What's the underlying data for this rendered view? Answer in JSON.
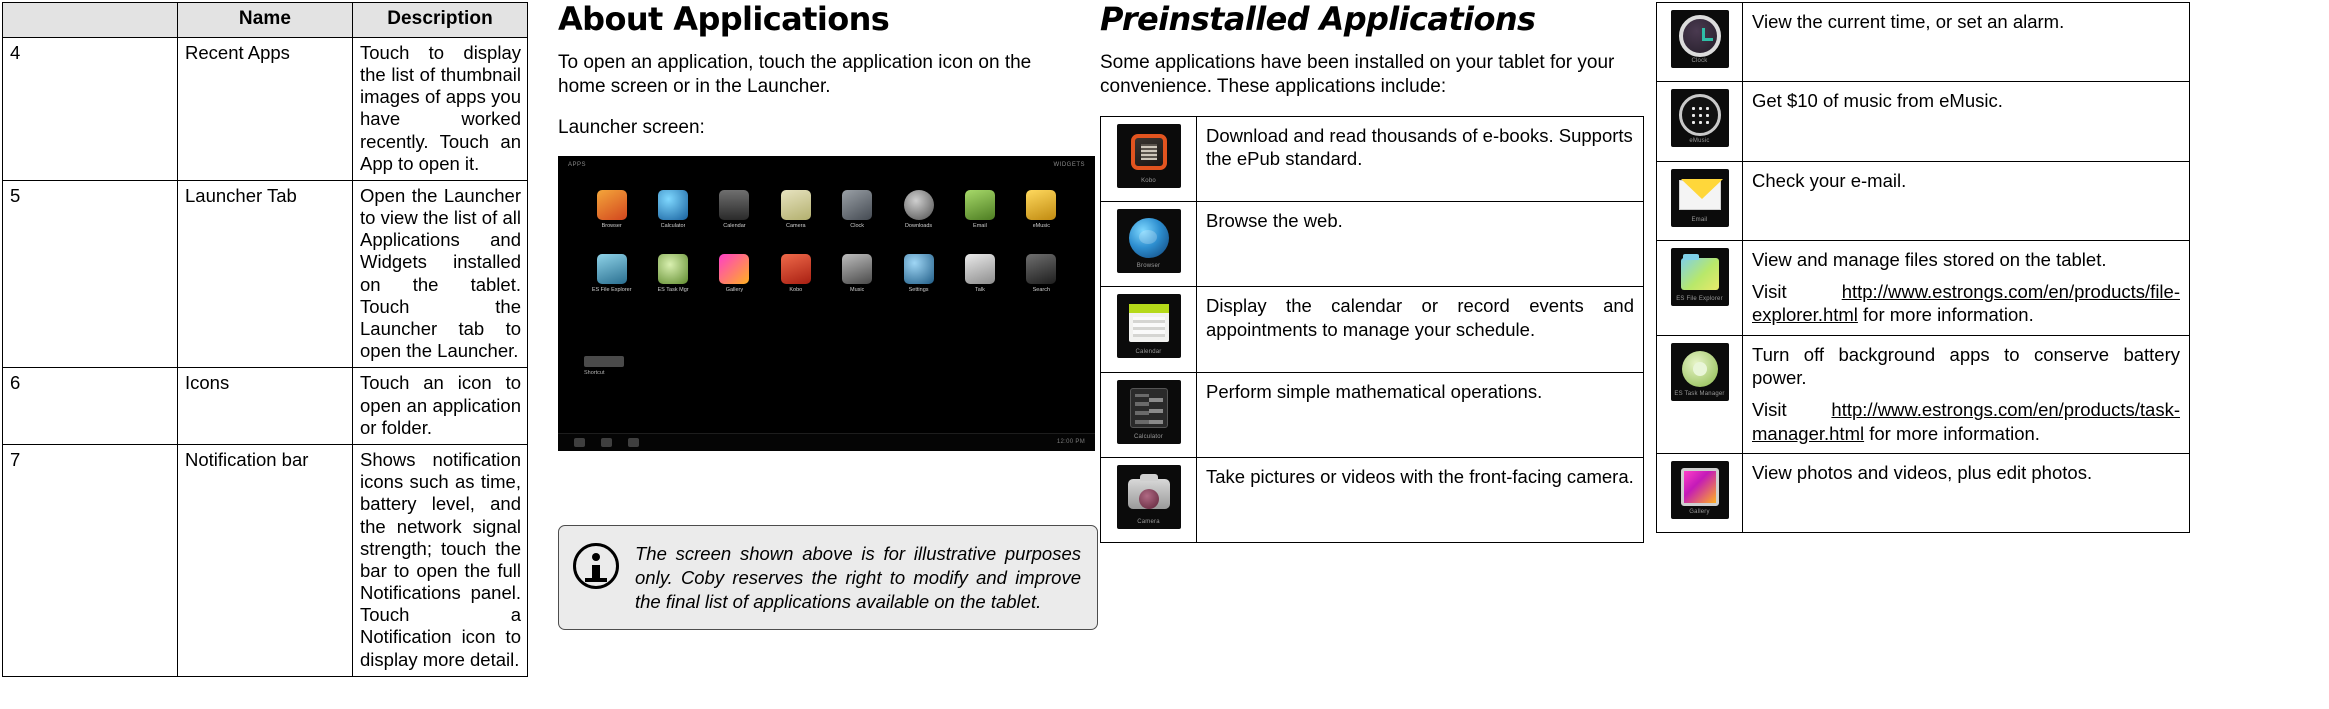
{
  "feature_table": {
    "headers": [
      "",
      "Name",
      "Description"
    ],
    "rows": [
      {
        "num": "4",
        "name": "Recent Apps",
        "desc": "Touch to display the list of thumbnail images of apps you have worked recently. Touch an App to open it."
      },
      {
        "num": "5",
        "name": "Launcher Tab",
        "desc": "Open the Launcher to view the list of all Applications and Widgets installed on the tablet. Touch the Launcher tab to open the Launcher."
      },
      {
        "num": "6",
        "name": "Icons",
        "desc": "Touch an icon to open an application or folder."
      },
      {
        "num": "7",
        "name": "Notification bar",
        "desc": "Shows notification icons such as time, battery level, and the network signal strength; touch the bar to open the full Notifications panel. Touch a Notification icon to display more detail."
      }
    ]
  },
  "about": {
    "title": "About Applications",
    "paragraph": "To open an application, touch the application icon on the home screen or in the Launcher.",
    "caption": "Launcher screen:",
    "screenshot": {
      "statusbar_left": "APPS",
      "statusbar_right": "WIDGETS",
      "navbar_right": "12:00 PM",
      "dock_label": "Shortcut",
      "apps_row1": [
        "Browser",
        "Calculator",
        "Calendar",
        "Camera",
        "Clock",
        "Downloads",
        "Email",
        "eMusic"
      ],
      "apps_row2": [
        "ES File Explorer",
        "ES Task Mgr",
        "Gallery",
        "Kobo",
        "Music",
        "Settings",
        "Talk",
        "Search"
      ]
    },
    "note": "The screen shown above is for illustrative purposes only. Coby reserves the right to modify  and improve the final list of applications available on the tablet."
  },
  "preinstalled": {
    "title": "Preinstalled Applications",
    "paragraph": "Some applications have been installed on your tablet for your convenience. These applications include:",
    "rows": [
      {
        "icon": "ebook-reader-icon",
        "icon_label": "Kobo",
        "desc": "Download and read thousands of e-books. Supports the ePub standard."
      },
      {
        "icon": "browser-icon",
        "icon_label": "Browser",
        "desc": "Browse the web."
      },
      {
        "icon": "calendar-icon",
        "icon_label": "Calendar",
        "desc": "Display the calendar or record events and appointments to manage your schedule."
      },
      {
        "icon": "calculator-icon",
        "icon_label": "Calculator",
        "desc": "Perform simple mathematical operations."
      },
      {
        "icon": "camera-icon",
        "icon_label": "Camera",
        "desc": "Take pictures or videos with the front-facing camera."
      }
    ]
  },
  "extra": {
    "rows": [
      {
        "icon": "clock-icon",
        "icon_label": "Clock",
        "desc": "View the current time, or set an alarm."
      },
      {
        "icon": "emusic-icon",
        "icon_label": "eMusic",
        "desc": "Get $10 of music from eMusic."
      },
      {
        "icon": "email-icon",
        "icon_label": "Email",
        "desc": "Check your e-mail."
      },
      {
        "icon": "file-explorer-icon",
        "icon_label": "ES File Explorer",
        "desc": "View and manage files stored on the tablet.",
        "visit_prefix": "Visit ",
        "url": "http://www.estrongs.com/en/products/file-explorer.html",
        "visit_suffix": " for more information."
      },
      {
        "icon": "task-manager-icon",
        "icon_label": "ES Task Manager",
        "desc": "Turn off background apps to conserve battery power.",
        "visit_prefix": "Visit ",
        "url": "http://www.estrongs.com/en/products/task-manager.html",
        "visit_suffix": " for more information."
      },
      {
        "icon": "gallery-icon",
        "icon_label": "Gallery",
        "desc": "View photos and videos, plus edit photos."
      }
    ]
  }
}
